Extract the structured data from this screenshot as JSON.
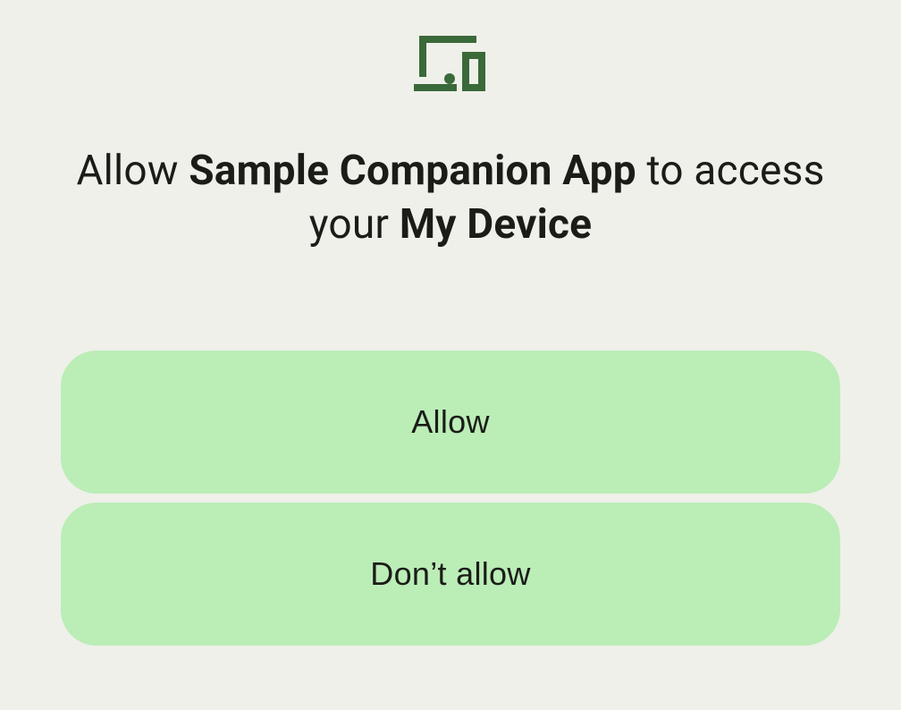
{
  "dialog": {
    "title": {
      "prefix": "Allow ",
      "app_name": "Sample Companion App",
      "middle": " to access your ",
      "device_name": "My Device"
    },
    "buttons": {
      "allow": "Allow",
      "deny": "Don’t allow"
    },
    "icon": {
      "name": "devices-icon",
      "color": "#3a693a"
    }
  }
}
